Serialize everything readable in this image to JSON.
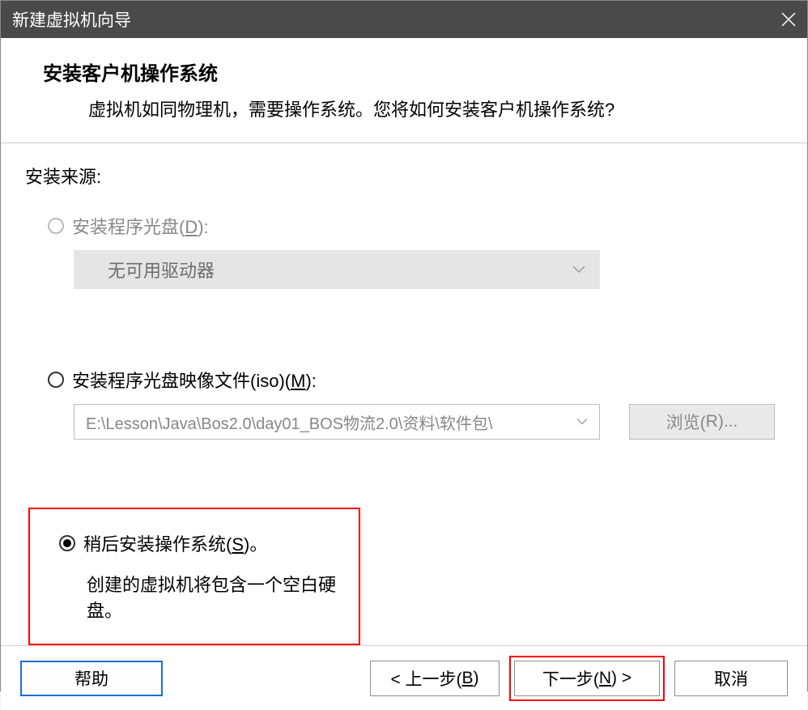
{
  "window": {
    "title": "新建虚拟机向导"
  },
  "header": {
    "title": "安装客户机操作系统",
    "subtitle": "虚拟机如同物理机，需要操作系统。您将如何安装客户机操作系统?"
  },
  "content": {
    "source_label": "安装来源:",
    "option_disc": {
      "label_pre": "安装程序光盘(",
      "mnemonic": "D",
      "label_post": "):",
      "dropdown_value": "无可用驱动器"
    },
    "option_iso": {
      "label_pre": "安装程序光盘映像文件(iso)(",
      "mnemonic": "M",
      "label_post": "):",
      "path": "E:\\Lesson\\Java\\Bos2.0\\day01_BOS物流2.0\\资料\\软件包\\",
      "browse_pre": "浏览(",
      "browse_mn": "R",
      "browse_post": ")..."
    },
    "option_later": {
      "label_pre": "稍后安装操作系统(",
      "mnemonic": "S",
      "label_post": ")。",
      "description": "创建的虚拟机将包含一个空白硬盘。"
    }
  },
  "footer": {
    "help": "帮助",
    "back_pre": "< 上一步(",
    "back_mn": "B",
    "back_post": ")",
    "next_pre": "下一步(",
    "next_mn": "N",
    "next_post": ") >",
    "cancel": "取消"
  }
}
